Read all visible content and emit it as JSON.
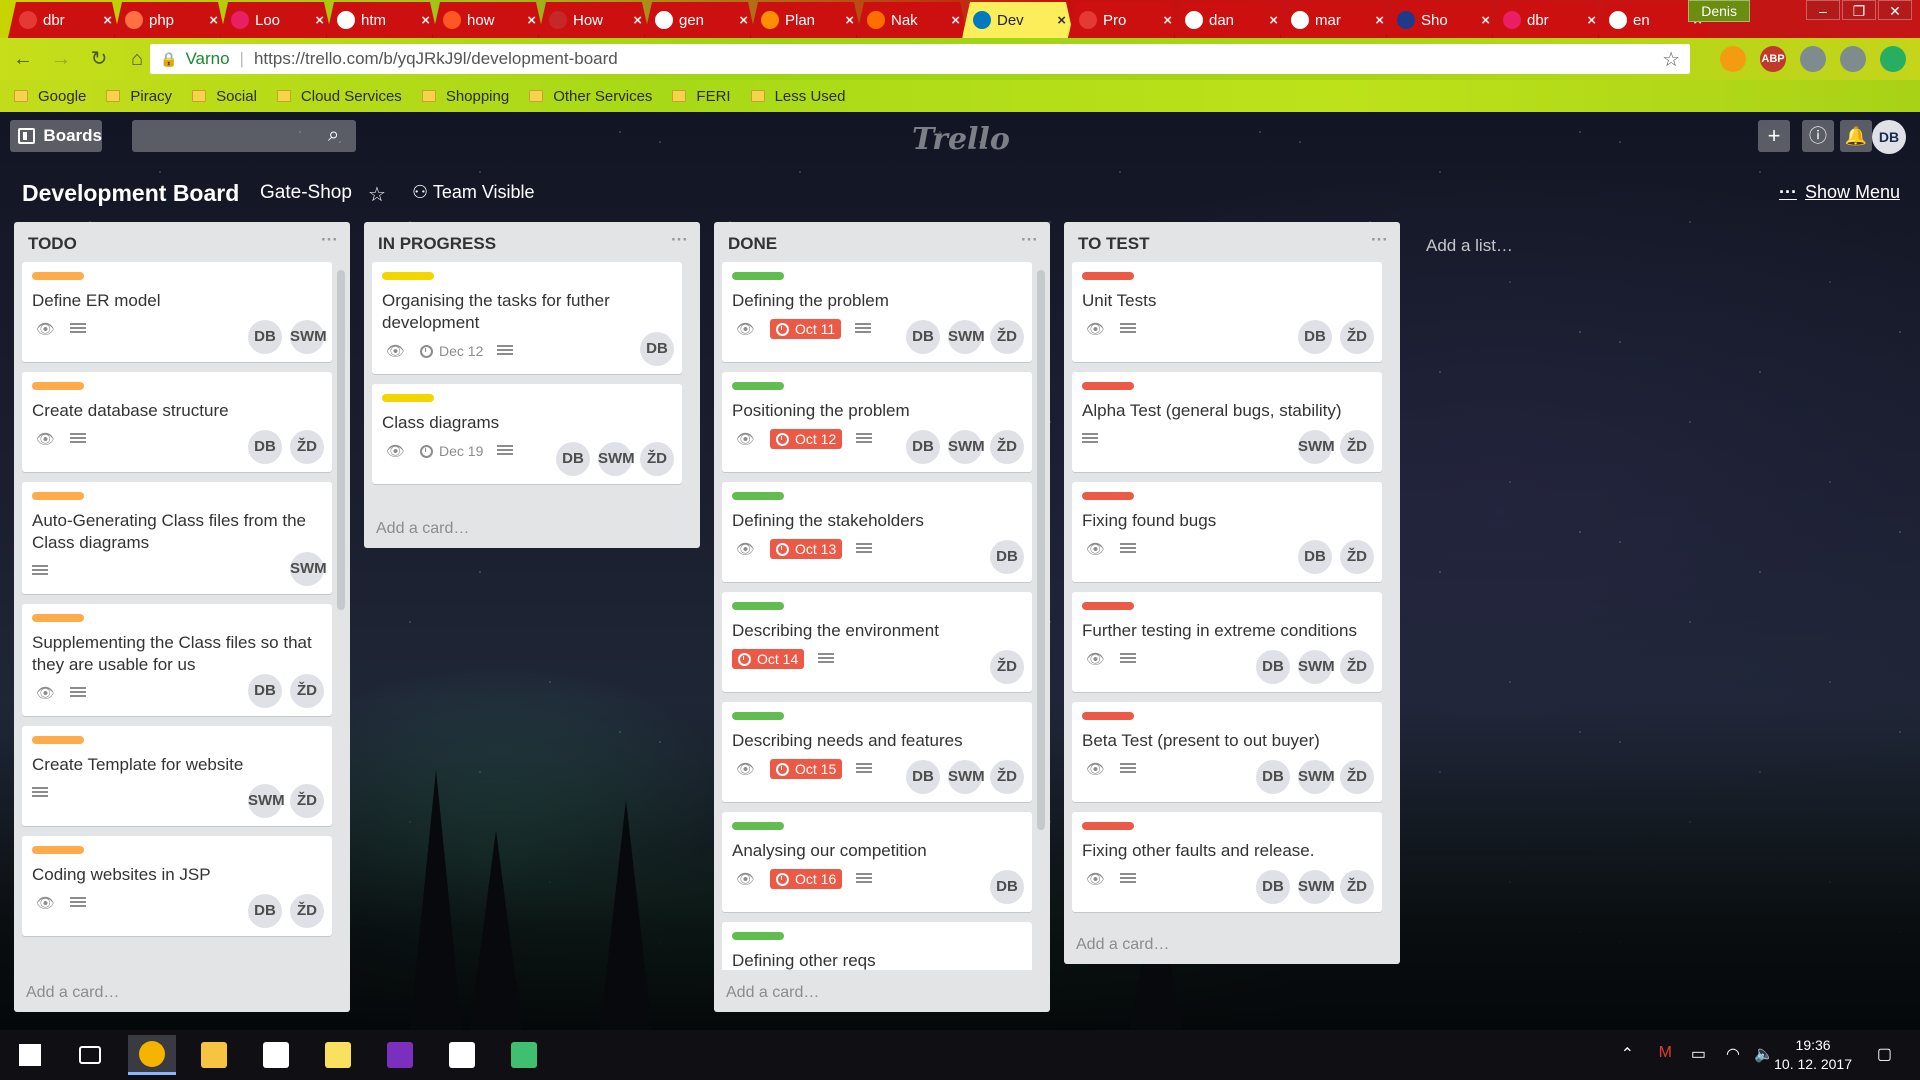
{
  "browser": {
    "tabs": [
      {
        "title": "dbr",
        "color": "#e53935",
        "active": false
      },
      {
        "title": "php",
        "color": "#ff7043",
        "active": false
      },
      {
        "title": "Loo",
        "color": "#e91e63",
        "active": false
      },
      {
        "title": "htm",
        "color": "#ffffff",
        "active": false
      },
      {
        "title": "how",
        "color": "#ff5722",
        "active": false
      },
      {
        "title": "How",
        "color": "#c62828",
        "active": false
      },
      {
        "title": "gen",
        "color": "#ffffff",
        "active": false
      },
      {
        "title": "Plan",
        "color": "#ff8f00",
        "active": false
      },
      {
        "title": "Nak",
        "color": "#ff6f00",
        "active": false
      },
      {
        "title": "Dev",
        "color": "#0079bf",
        "active": true
      },
      {
        "title": "Pro",
        "color": "#e53935",
        "active": false
      },
      {
        "title": "dan",
        "color": "#ffffff",
        "active": false
      },
      {
        "title": "mar",
        "color": "#ffffff",
        "active": false
      },
      {
        "title": "Sho",
        "color": "#1e3a8a",
        "active": false
      },
      {
        "title": "dbr",
        "color": "#e91e63",
        "active": false
      },
      {
        "title": "en",
        "color": "#ffffff",
        "active": false
      }
    ],
    "user": "Denis",
    "window_controls": [
      "–",
      "❐",
      "✕"
    ],
    "address": {
      "secure_label": "Varno",
      "url": "https://trello.com/b/yqJRkJ9l/development-board"
    },
    "extensions": [
      {
        "name": "key-extension",
        "label": "",
        "color": "#f39c12"
      },
      {
        "name": "adblock-extension",
        "label": "ABP",
        "color": "#c0392b"
      },
      {
        "name": "bulb-extension",
        "label": "",
        "color": "#7f8c8d"
      },
      {
        "name": "pocket-extension",
        "label": "",
        "color": "#7f8c8d"
      },
      {
        "name": "update-extension",
        "label": "",
        "color": "#27ae60"
      }
    ],
    "bookmarks": [
      "Google",
      "Piracy",
      "Social",
      "Cloud Services",
      "Shopping",
      "Other Services",
      "FERI",
      "Less Used"
    ]
  },
  "trello": {
    "boards_label": "Boards",
    "search_placeholder": "",
    "logo": "Trello",
    "me_initials": "DB",
    "board_title": "Development Board",
    "team": "Gate-Shop",
    "visibility": "Team Visible",
    "show_menu": "Show Menu",
    "add_list": "Add a list…",
    "add_card": "Add a card…",
    "lists": [
      {
        "name": "TODO",
        "cards": [
          {
            "label": "#ffab4a",
            "title": "Define ER model",
            "watch": true,
            "desc": true,
            "due": "",
            "overdue": false,
            "members": [
              "DB",
              "SWM"
            ]
          },
          {
            "label": "#ffab4a",
            "title": "Create database structure",
            "watch": true,
            "desc": true,
            "due": "",
            "overdue": false,
            "members": [
              "DB",
              "ŽD"
            ]
          },
          {
            "label": "#ffab4a",
            "title": "Auto-Generating Class files from the Class diagrams",
            "watch": false,
            "desc": true,
            "due": "",
            "overdue": false,
            "members": [
              "SWM"
            ]
          },
          {
            "label": "#ffab4a",
            "title": "Supplementing the Class files so that they are usable for us",
            "watch": true,
            "desc": true,
            "due": "",
            "overdue": false,
            "members": [
              "DB",
              "ŽD"
            ]
          },
          {
            "label": "#ffab4a",
            "title": "Create Template for website",
            "watch": false,
            "desc": true,
            "due": "",
            "overdue": false,
            "members": [
              "SWM",
              "ŽD"
            ]
          },
          {
            "label": "#ffab4a",
            "title": "Coding websites in JSP",
            "watch": true,
            "desc": true,
            "due": "",
            "overdue": false,
            "members": [
              "DB",
              "ŽD"
            ]
          }
        ]
      },
      {
        "name": "IN PROGRESS",
        "cards": [
          {
            "label": "#f2d600",
            "title": "Organising the tasks for futher development",
            "watch": true,
            "desc": true,
            "due": "Dec 12",
            "overdue": false,
            "members": [
              "DB"
            ]
          },
          {
            "label": "#f2d600",
            "title": "Class diagrams",
            "watch": true,
            "desc": true,
            "due": "Dec 19",
            "overdue": false,
            "members": [
              "DB",
              "SWM",
              "ŽD"
            ]
          }
        ]
      },
      {
        "name": "DONE",
        "cards": [
          {
            "label": "#61bd4f",
            "title": "Defining the problem",
            "watch": true,
            "desc": true,
            "due": "Oct 11",
            "overdue": true,
            "members": [
              "DB",
              "SWM",
              "ŽD"
            ]
          },
          {
            "label": "#61bd4f",
            "title": "Positioning the problem",
            "watch": true,
            "desc": true,
            "due": "Oct 12",
            "overdue": true,
            "members": [
              "DB",
              "SWM",
              "ŽD"
            ]
          },
          {
            "label": "#61bd4f",
            "title": "Defining the stakeholders",
            "watch": true,
            "desc": true,
            "due": "Oct 13",
            "overdue": true,
            "members": [
              "DB"
            ]
          },
          {
            "label": "#61bd4f",
            "title": "Describing the environment",
            "watch": false,
            "desc": true,
            "due": "Oct 14",
            "overdue": true,
            "members": [
              "ŽD"
            ]
          },
          {
            "label": "#61bd4f",
            "title": "Describing needs and features",
            "watch": true,
            "desc": true,
            "due": "Oct 15",
            "overdue": true,
            "members": [
              "DB",
              "SWM",
              "ŽD"
            ]
          },
          {
            "label": "#61bd4f",
            "title": "Analysing our competition",
            "watch": true,
            "desc": true,
            "due": "Oct 16",
            "overdue": true,
            "members": [
              "DB"
            ]
          },
          {
            "label": "#61bd4f",
            "title": "Defining other reqs",
            "watch": false,
            "desc": false,
            "due": "",
            "overdue": false,
            "members": []
          }
        ]
      },
      {
        "name": "TO TEST",
        "cards": [
          {
            "label": "#eb5a46",
            "title": "Unit Tests",
            "watch": true,
            "desc": true,
            "due": "",
            "overdue": false,
            "members": [
              "DB",
              "ŽD"
            ]
          },
          {
            "label": "#eb5a46",
            "title": "Alpha Test (general bugs, stability)",
            "watch": false,
            "desc": true,
            "due": "",
            "overdue": false,
            "members": [
              "SWM",
              "ŽD"
            ]
          },
          {
            "label": "#eb5a46",
            "title": "Fixing found bugs",
            "watch": true,
            "desc": true,
            "due": "",
            "overdue": false,
            "members": [
              "DB",
              "ŽD"
            ]
          },
          {
            "label": "#eb5a46",
            "title": "Further testing in extreme conditions",
            "watch": true,
            "desc": true,
            "due": "",
            "overdue": false,
            "members": [
              "DB",
              "SWM",
              "ŽD"
            ]
          },
          {
            "label": "#eb5a46",
            "title": "Beta Test (present to out buyer)",
            "watch": true,
            "desc": true,
            "due": "",
            "overdue": false,
            "members": [
              "DB",
              "SWM",
              "ŽD"
            ]
          },
          {
            "label": "#eb5a46",
            "title": "Fixing other faults and release.",
            "watch": true,
            "desc": true,
            "due": "",
            "overdue": false,
            "members": [
              "DB",
              "SWM",
              "ŽD"
            ]
          }
        ]
      }
    ]
  },
  "taskbar": {
    "apps": [
      {
        "name": "start-button",
        "color": "#ffffff"
      },
      {
        "name": "task-view-button",
        "color": "#ffffff"
      },
      {
        "name": "chrome-app",
        "color": "#f4b400"
      },
      {
        "name": "explorer-app",
        "color": "#f5c542"
      },
      {
        "name": "mail-app",
        "color": "#ffffff"
      },
      {
        "name": "sticky-notes-app",
        "color": "#f9e05e"
      },
      {
        "name": "onenote-app",
        "color": "#7b2fbf"
      },
      {
        "name": "calendar-app",
        "color": "#ffffff"
      },
      {
        "name": "network-app",
        "color": "#3fbf6f"
      }
    ],
    "time": "19:36",
    "date": "10. 12. 2017"
  }
}
